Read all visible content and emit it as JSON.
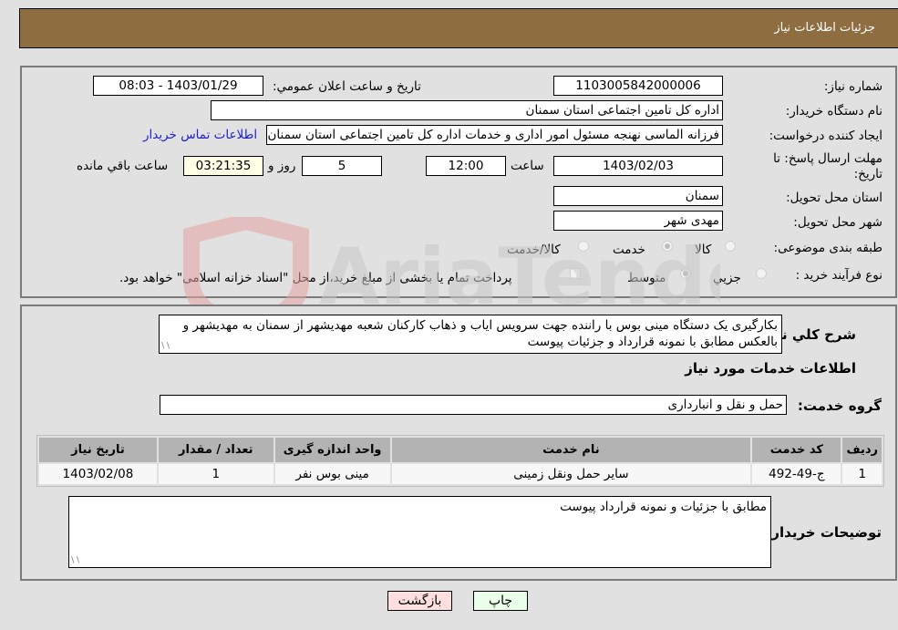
{
  "header": {
    "title": "جزئیات اطلاعات نیاز"
  },
  "form": {
    "need_number": {
      "label": "شماره نیاز:",
      "value": "1103005842000006"
    },
    "announce_datetime": {
      "label": "تاریخ و ساعت اعلان عمومي:",
      "value": "1403/01/29 - 08:03"
    },
    "buyer_org": {
      "label": "نام دستگاه خريدار:",
      "value": "اداره کل تامین اجتماعی استان سمنان"
    },
    "requester": {
      "label": "ایجاد کننده درخواست:",
      "value": "فرزانه الماسی نهنجه مسئول امور اداری و خدمات اداره کل تامین اجتماعی استان سمنان"
    },
    "buyer_contact_link": "اطلاعات تماس خریدار",
    "deadline": {
      "label_line1": "مهلت ارسال پاسخ: تا",
      "label_line2": "تاریخ:",
      "date": "1403/02/03",
      "time_label": "ساعت",
      "time": "12:00",
      "days": "5",
      "days_label": "روز و",
      "remaining": "03:21:35",
      "remaining_label": "ساعت باقي مانده"
    },
    "delivery_province": {
      "label": "استان محل تحویل:",
      "value": "سمنان"
    },
    "delivery_city": {
      "label": "شهر محل تحویل:",
      "value": "مهدی شهر"
    },
    "category": {
      "label": "طبقه بندی موضوعی:",
      "options": [
        "کالا",
        "خدمت",
        "کالا/خدمت"
      ],
      "selected": "خدمت"
    },
    "purchase_type": {
      "label": "نوع فرآیند خرید :",
      "options": [
        "جزيي",
        "متوسط"
      ],
      "selected": "متوسط",
      "treasury_checkbox_label": "پرداخت تمام یا بخشی از مبلغ خرید،از محل \"اسناد خزانه اسلامی\" خواهد بود.",
      "treasury_checked": false
    }
  },
  "details": {
    "description_label": "شرح کلي نياز:",
    "description": "بکارگیری یک دستگاه مینی بوس با راننده جهت سرویس ایاب و ذهاب کارکنان شعبه مهدیشهر از سمنان به مهدیشهر و بالعکس مطابق با نمونه قرارداد و جزئیات پیوست",
    "services_heading": "اطلاعات خدمات مورد نياز",
    "service_group_label": "گروه خدمت:",
    "service_group": "حمل و نقل و انبارداری",
    "table": {
      "headers": [
        "ردیف",
        "کد خدمت",
        "نام خدمت",
        "واحد اندازه گیری",
        "تعداد / مقدار",
        "تاریخ نیاز"
      ],
      "rows": [
        [
          "1",
          "ج-49-492",
          "سایر حمل ونقل زمینی",
          "مینی بوس نفر",
          "1",
          "1403/02/08"
        ]
      ]
    },
    "buyer_notes_label": "توضیحات خریدار:",
    "buyer_notes": "مطابق با جزئیات و نمونه قرارداد پیوست"
  },
  "buttons": {
    "print": "چاپ",
    "back": "بازگشت"
  },
  "watermark": {
    "text": "AriaTender.neT"
  }
}
